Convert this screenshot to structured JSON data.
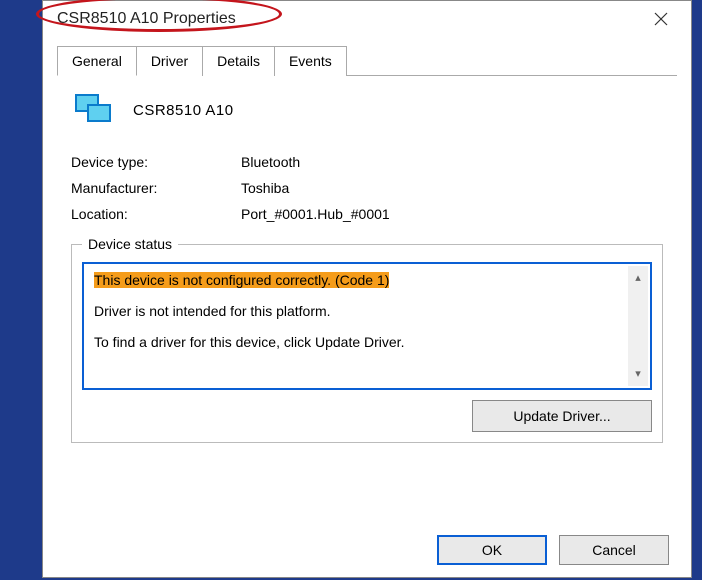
{
  "titlebar": {
    "title": "CSR8510 A10 Properties"
  },
  "tabs": [
    {
      "label": "General"
    },
    {
      "label": "Driver"
    },
    {
      "label": "Details"
    },
    {
      "label": "Events"
    }
  ],
  "device": {
    "name": "CSR8510 A10",
    "rows": {
      "type_label": "Device type:",
      "type_value": "Bluetooth",
      "mfr_label": "Manufacturer:",
      "mfr_value": "Toshiba",
      "loc_label": "Location:",
      "loc_value": "Port_#0001.Hub_#0001"
    }
  },
  "status": {
    "legend": "Device status",
    "line1": "This device is not configured correctly. (Code 1)",
    "line2": "Driver is not intended for this platform.",
    "line3": "To find a driver for this device, click Update Driver."
  },
  "buttons": {
    "update": "Update Driver...",
    "ok": "OK",
    "cancel": "Cancel"
  }
}
